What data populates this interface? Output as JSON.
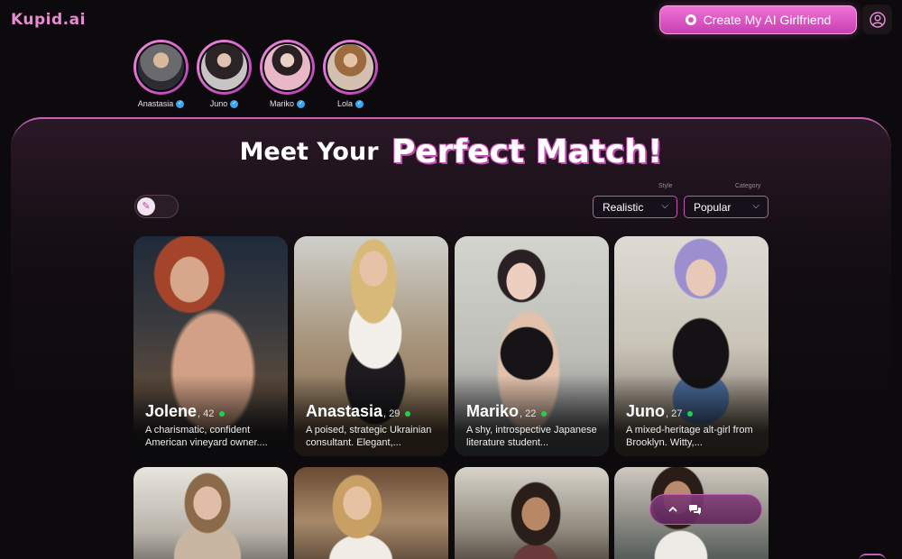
{
  "header": {
    "logo": "Kupid.ai",
    "create_label": "Create My AI Girlfriend"
  },
  "stories": [
    {
      "name": "Anastasia",
      "verified": true
    },
    {
      "name": "Juno",
      "verified": true
    },
    {
      "name": "Mariko",
      "verified": true
    },
    {
      "name": "Lola",
      "verified": true
    }
  ],
  "headline": {
    "part1": "Meet Your",
    "part2": "Perfect Match!"
  },
  "filters": {
    "style_caption": "Style",
    "style_value": "Realistic",
    "category_caption": "Category",
    "category_value": "Popular"
  },
  "cards": [
    {
      "name": "Jolene",
      "age": ", 42",
      "desc": "A charismatic, confident American vineyard owner....",
      "online": true
    },
    {
      "name": "Anastasia",
      "age": ", 29",
      "desc": "A poised, strategic Ukrainian consultant. Elegant,...",
      "online": true
    },
    {
      "name": "Mariko",
      "age": ", 22",
      "desc": "A shy, introspective Japanese literature student...",
      "online": true
    },
    {
      "name": "Juno",
      "age": ", 27",
      "desc": "A mixed-heritage alt-girl from Brooklyn. Witty,...",
      "online": true
    }
  ],
  "colors": {
    "accent": "#e35bc9",
    "online": "#22d14a",
    "verified": "#3aa5f0"
  }
}
